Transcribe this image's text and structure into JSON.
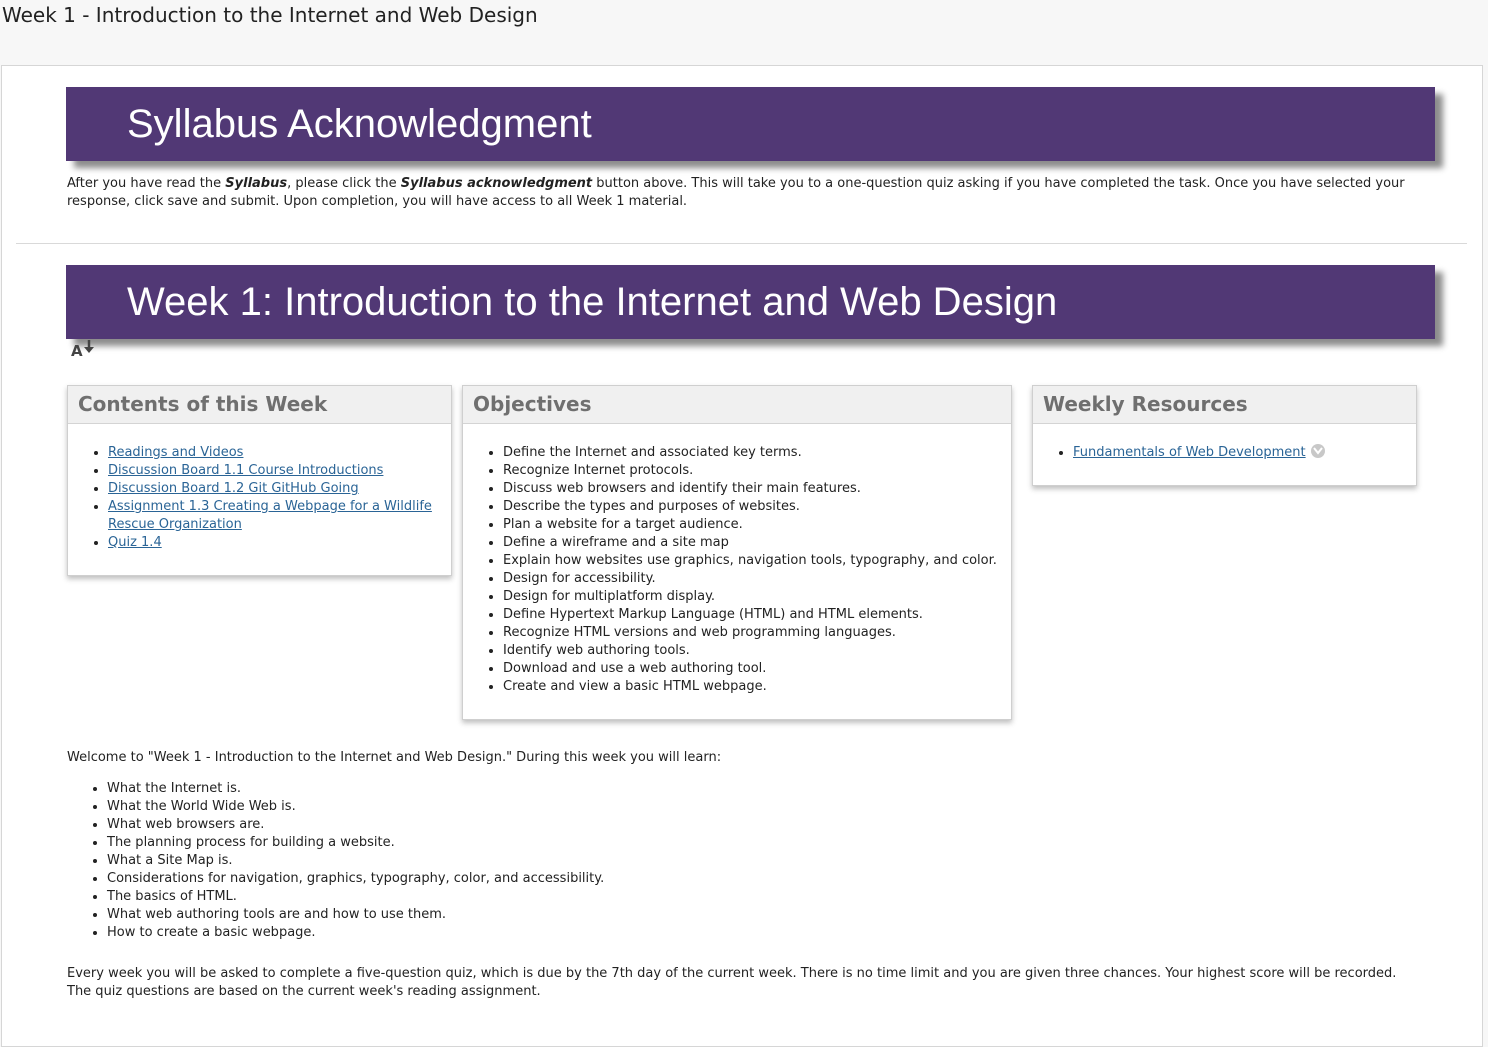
{
  "page": {
    "title": "Week 1 - Introduction to the Internet and Web Design"
  },
  "syllabus": {
    "banner": "Syllabus Acknowledgment",
    "text_1": "After you have read the ",
    "emph_1": "Syllabus",
    "text_2": ", please click the ",
    "emph_2": "Syllabus acknowledgment",
    "text_3": " button above. This will take you to a one-question quiz asking if you have completed the task. Once you have selected your response, click save and submit. Upon completion, you will have access to all Week 1 material."
  },
  "week": {
    "banner": "Week 1: Introduction to the Internet and Web Design",
    "textsize_icon": "text-size-icon"
  },
  "contents_panel": {
    "title": "Contents of this Week",
    "links": [
      "Readings and Videos",
      "Discussion Board 1.1 Course Introductions",
      "Discussion Board 1.2 Git GitHub Going",
      "Assignment 1.3 Creating a Webpage for a Wildlife Rescue Organization",
      "Quiz 1.4"
    ]
  },
  "objectives_panel": {
    "title": "Objectives",
    "items": [
      "Define the Internet and associated key terms.",
      "Recognize Internet protocols.",
      "Discuss web browsers and identify their main features.",
      "Describe the types and purposes of websites.",
      "Plan a website for a target audience.",
      "Define a wireframe and a site map",
      "Explain how websites use graphics, navigation tools, typography, and color.",
      "Design for accessibility.",
      "Design for multiplatform display.",
      "Define Hypertext Markup Language (HTML) and HTML elements.",
      "Recognize HTML versions and web programming languages.",
      "Identify web authoring tools.",
      "Download and use a web authoring tool.",
      "Create and view a basic HTML webpage."
    ]
  },
  "resources_panel": {
    "title": "Weekly Resources",
    "links": [
      "Fundamentals of Web Development"
    ]
  },
  "welcome": {
    "intro": "Welcome to \"Week 1 - Introduction to the Internet and Web Design.\"  During this week you will learn:",
    "items": [
      "What the Internet is.",
      "What the World Wide Web is.",
      "What web browsers are.",
      "The planning process for building a website.",
      "What a Site Map is.",
      "Considerations for navigation, graphics, typography, color, and accessibility.",
      "The basics of HTML.",
      "What web authoring tools are and how to use them.",
      "How to create a basic webpage."
    ],
    "quiz_note": "Every week you will be asked to complete a five-question quiz, which is due by the 7th day of the current week.  There is no time limit and you are given three chances.  Your highest score will be recorded.  The quiz questions are based on the current week's reading assignment."
  },
  "colors": {
    "banner": "#513875",
    "link": "#2a6496",
    "panel_header_text": "#6f6f6f"
  }
}
